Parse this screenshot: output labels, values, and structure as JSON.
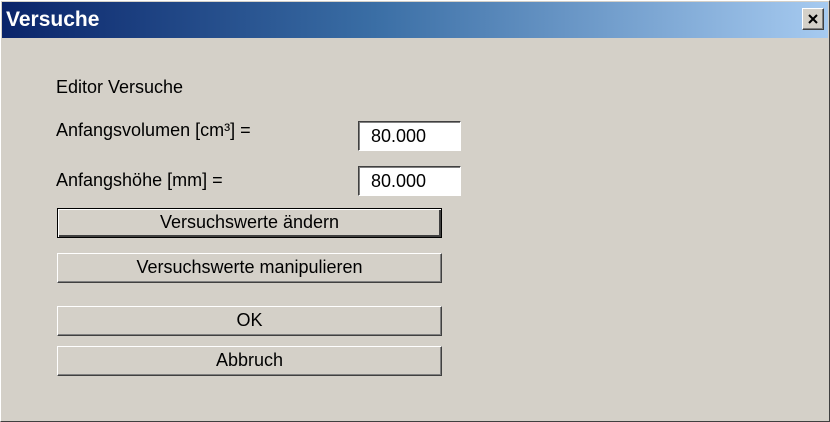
{
  "window": {
    "title": "Versuche",
    "close_symbol": "close-icon"
  },
  "dialog": {
    "heading": "Editor Versuche",
    "fields": [
      {
        "label": "Anfangsvolumen [cm³] =",
        "value": "80.000"
      },
      {
        "label": "Anfangshöhe [mm] =",
        "value": "80.000"
      }
    ],
    "buttons": [
      {
        "label": "Versuchswerte ändern"
      },
      {
        "label": "Versuchswerte manipulieren"
      },
      {
        "label": "OK"
      },
      {
        "label": "Abbruch"
      }
    ]
  },
  "colors": {
    "face": "#d4d0c8",
    "title_start": "#0a246a",
    "title_end": "#a6caf0"
  }
}
